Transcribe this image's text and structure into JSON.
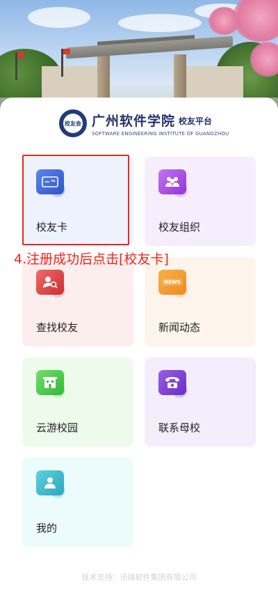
{
  "header": {
    "seal_text": "校友会",
    "school_name": "广州软件学院",
    "platform_name": "校友平台",
    "english_name": "SOFTWARE ENGINEERING INSTITUTE OF GUANGZHOU"
  },
  "tiles": [
    {
      "label": "校友卡",
      "icon": "card-icon",
      "bg": "#eef2fd",
      "icon_color": "#3b63d6",
      "shadow": "#9db0ef"
    },
    {
      "label": "校友组织",
      "icon": "group-icon",
      "bg": "#f6eefc",
      "icon_color": "#a548e0",
      "shadow": "#d6a6f3"
    },
    {
      "label": "查找校友",
      "icon": "search-person-icon",
      "bg": "#fdeeee",
      "icon_color": "#e04444",
      "shadow": "#f1aaaa"
    },
    {
      "label": "新闻动态",
      "icon": "news-icon",
      "bg": "#fdf4ec",
      "icon_color": "#f39a2a",
      "shadow": "#f8cf9a"
    },
    {
      "label": "云游校园",
      "icon": "campus-icon",
      "bg": "#eefbec",
      "icon_color": "#3cc43c",
      "shadow": "#a6e8a6"
    },
    {
      "label": "联系母校",
      "icon": "phone-icon",
      "bg": "#f3eefb",
      "icon_color": "#7a3fd0",
      "shadow": "#c3a6ee"
    },
    {
      "label": "我的",
      "icon": "profile-icon",
      "bg": "#ecfbfc",
      "icon_color": "#2ab5c8",
      "shadow": "#9fdbe6"
    }
  ],
  "news_badge": "NEWS",
  "annotation": "4.注册成功后点击[校友卡]",
  "footer": "技术支持：讯瑞软件集团有限公司",
  "colors": {
    "annotation_red": "#e8281e",
    "brand_blue": "#23346f"
  }
}
